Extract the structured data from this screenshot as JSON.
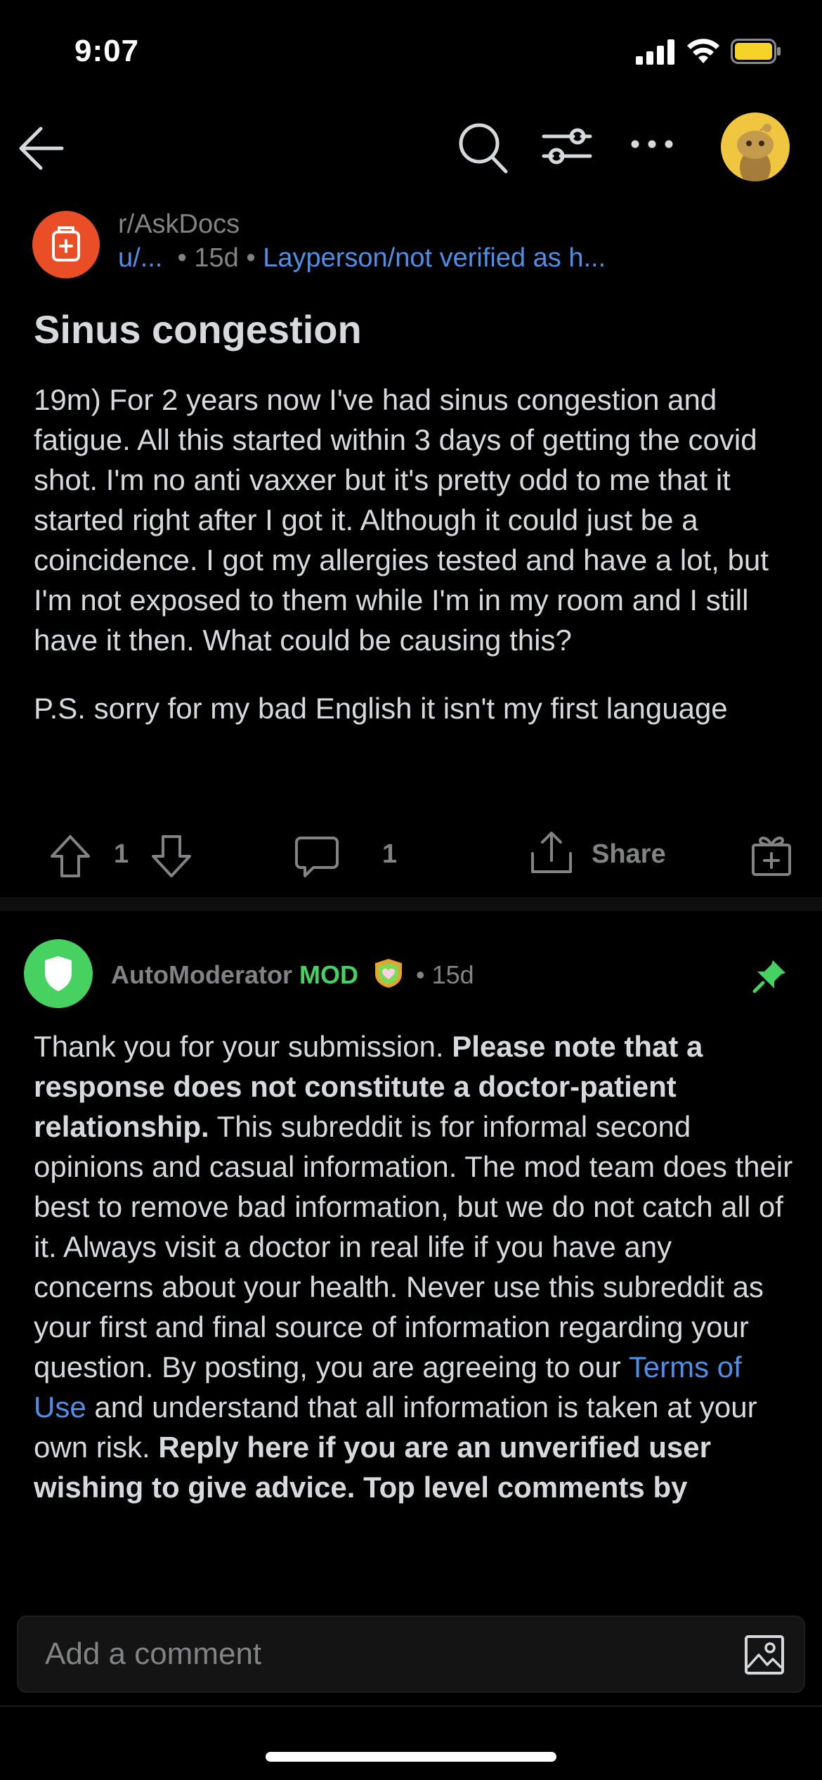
{
  "status_bar": {
    "time": "9:07"
  },
  "nav": {
    "back_icon": "arrow-left-icon",
    "search_icon": "search-icon",
    "filter_icon": "sort-filter-icon",
    "more_icon": "more-horizontal-icon",
    "avatar_icon": "snoo-avatar-icon"
  },
  "post": {
    "subreddit": "r/AskDocs",
    "user": "u/...",
    "age": "15d",
    "flair": "Layperson/not verified as h...",
    "title": "Sinus congestion",
    "paragraphs": [
      "19m) For 2 years now I've had sinus congestion and fatigue. All this started within 3 days of getting the covid shot. I'm no anti vaxxer but it's pretty odd to me that it started right after I got it. Although it could just be a coincidence. I got my allergies tested and have a lot, but I'm not exposed to them while I'm in my room and I still have it then. What could be causing this?",
      "P.S. sorry for my bad English it isn't my first language"
    ],
    "upvotes": "1",
    "comments": "1",
    "share_label": "Share"
  },
  "comment": {
    "author": "AutoModerator",
    "mod_tag": "MOD",
    "age": "15d",
    "body": {
      "t1": "Thank you for your submission. ",
      "b1": "Please note that a response does not constitute a doctor-patient relationship.",
      "t2": " This subreddit is for informal second opinions and casual information. The mod team does their best to remove bad information, but we do not catch all of it. Always visit a doctor in real life if you have any concerns about your health. Never use this subreddit as your first and final source of information regarding your question. By posting, you are agreeing to our ",
      "link": "Terms of Use",
      "t3": " and understand that all information is taken at your own risk. ",
      "b2": "Reply here if you are an unverified user wishing to give advice. Top level comments by"
    }
  },
  "composer": {
    "placeholder": "Add a comment"
  },
  "colors": {
    "background": "#000000",
    "text": "#d7dadc",
    "muted": "#818384",
    "link": "#4f8fe6",
    "mod_green": "#46d160",
    "subreddit_icon": "#ea4e26",
    "avatar_yellow": "#f0c53f"
  }
}
